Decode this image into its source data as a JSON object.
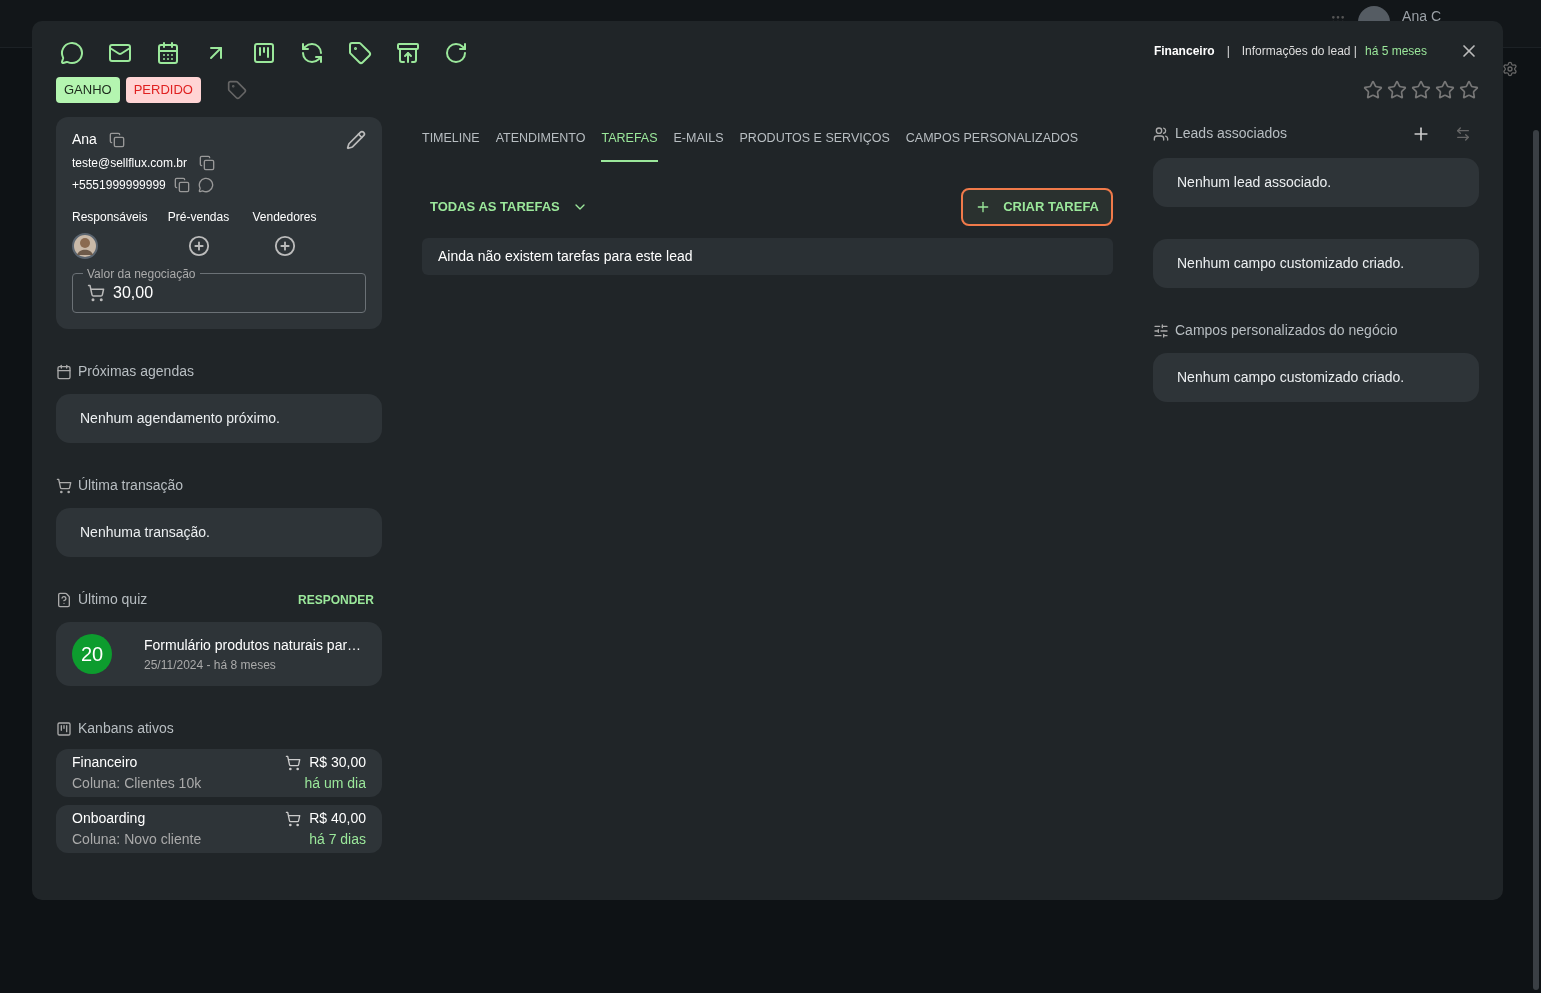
{
  "backdrop": {
    "user_name": "Ana C"
  },
  "header": {
    "kanban": "Financeiro",
    "separator": "|",
    "section": "Informações do lead |",
    "age": "há 5 meses"
  },
  "status_buttons": [
    {
      "label": "GANHO",
      "kind": "won"
    },
    {
      "label": "PERDIDO",
      "kind": "lost"
    }
  ],
  "rating": {
    "stars": 0
  },
  "contact": {
    "name": "Ana",
    "email": "teste@sellflux.com.br",
    "phone": "+5551999999999",
    "roles": [
      {
        "label": "Responsáveis",
        "assigned": true
      },
      {
        "label": "Pré-vendas",
        "assigned": false
      },
      {
        "label": "Vendedores",
        "assigned": false
      }
    ],
    "deal_value": {
      "label": "Valor da negociação",
      "value": "30,00"
    }
  },
  "upcoming": {
    "title": "Próximas agendas",
    "empty": "Nenhum agendamento próximo."
  },
  "last_transaction": {
    "title": "Última transação",
    "empty": "Nenhuma transação."
  },
  "quiz": {
    "title": "Último quiz",
    "action": "RESPONDER",
    "score": "20",
    "name": "Formulário produtos naturais par…",
    "date": "25/11/2024 - há 8 meses"
  },
  "kanbans": {
    "title": "Kanbans ativos",
    "items": [
      {
        "name": "Financeiro",
        "column": "Coluna: Clientes 10k",
        "value": "R$ 30,00",
        "age": "há um dia"
      },
      {
        "name": "Onboarding",
        "column": "Coluna: Novo cliente",
        "value": "R$ 40,00",
        "age": "há 7 dias"
      }
    ]
  },
  "tabs": [
    {
      "label": "TIMELINE",
      "selected": false
    },
    {
      "label": "ATENDIMENTO",
      "selected": false
    },
    {
      "label": "TAREFAS",
      "selected": true
    },
    {
      "label": "E-MAILS",
      "selected": false
    },
    {
      "label": "PRODUTOS E SERVIÇOS",
      "selected": false
    },
    {
      "label": "CAMPOS PERSONALIZADOS",
      "selected": false
    }
  ],
  "tasks": {
    "filter": "TODAS AS TAREFAS",
    "create": "CRIAR TAREFA",
    "empty": "Ainda não existem tarefas para este lead"
  },
  "associated_leads": {
    "title": "Leads associados",
    "empty": "Nenhum lead associado."
  },
  "custom_fields": {
    "empty": "Nenhum campo customizado criado."
  },
  "deal_custom_fields": {
    "title": "Campos personalizados do negócio",
    "empty": "Nenhum campo customizado criado."
  }
}
